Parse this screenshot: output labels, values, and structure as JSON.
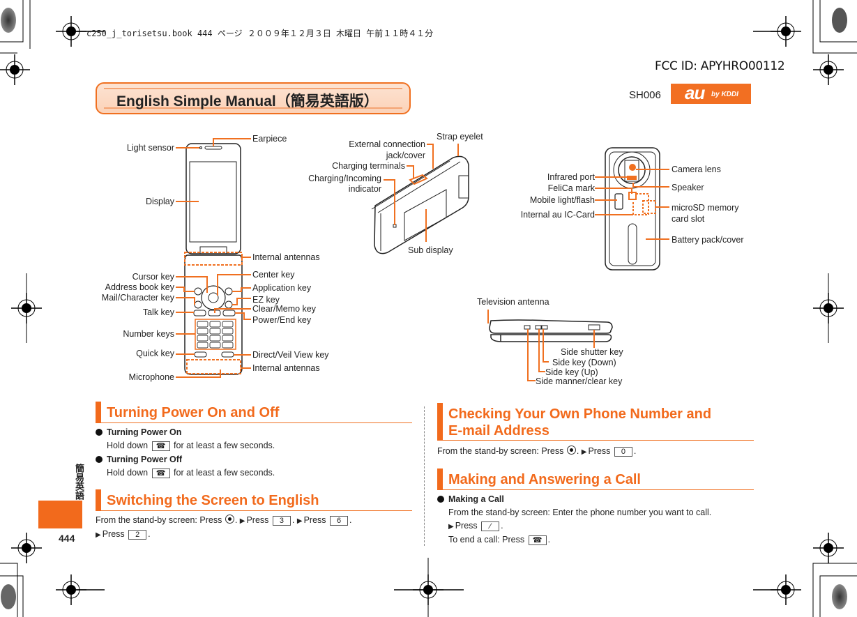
{
  "print_header": {
    "text": "c250_j_torisetsu.book  444 ページ  ２００９年１２月３日  木曜日  午前１１時４１分",
    "fcc_id": "FCC ID: APYHRO00112"
  },
  "title_banner": {
    "title": "English Simple Manual（簡易英語版）",
    "model": "SH006",
    "logo_main": "au",
    "logo_sub": "by KDDI"
  },
  "colors": {
    "accent": "#f26a1c",
    "banner_fill": "#fde3d2",
    "text": "#222222"
  },
  "diagram_front": {
    "labels_left": [
      "Light sensor",
      "Display",
      "Cursor key",
      "Address book key",
      "Mail/Character key",
      "Talk key",
      "Number keys",
      "Quick key",
      "Microphone"
    ],
    "labels_right": [
      "Earpiece",
      "Internal antennas",
      "Center key",
      "Application key",
      "EZ key",
      "Clear/Memo key",
      "Power/End key",
      "Direct/Veil View key",
      "Internal antennas"
    ]
  },
  "diagram_closed": {
    "labels": [
      "External connection",
      "jack/cover",
      "Strap eyelet",
      "Charging terminals",
      "Charging/Incoming",
      "indicator",
      "Sub display"
    ]
  },
  "diagram_back": {
    "labels_left": [
      "Infrared port",
      "FeliCa mark",
      "Mobile light/flash",
      "Internal au IC-Card"
    ],
    "labels_right": [
      "Camera lens",
      "Speaker",
      "microSD memory",
      "card slot",
      "Battery pack/cover"
    ]
  },
  "diagram_side": {
    "labels": [
      "Television antenna",
      "Side shutter key",
      "Side key (Down)",
      "Side key (Up)",
      "Side manner/clear key"
    ]
  },
  "sections": {
    "power": {
      "heading": "Turning Power On and Off",
      "items": [
        {
          "title": "Turning Power On",
          "pre": "Hold down",
          "key_icon": "power-end-key",
          "post": "for at least a few seconds."
        },
        {
          "title": "Turning Power Off",
          "pre": "Hold down",
          "key_icon": "power-end-key",
          "post": "for at least a few seconds."
        }
      ]
    },
    "english": {
      "heading": "Switching the Screen to English",
      "line1_a": "From the stand-by screen: Press",
      "press": "Press",
      "keys": [
        "3",
        "6",
        "2"
      ]
    },
    "own_number": {
      "heading_line1": "Checking Your Own Phone Number and",
      "heading_line2": "E-mail Address",
      "line_a": "From the stand-by screen: Press",
      "press": "Press",
      "key": "0"
    },
    "call": {
      "heading": "Making and Answering a Call",
      "item_title": "Making a Call",
      "line1": "From the stand-by screen: Enter the phone number you want to call.",
      "press": "Press",
      "line3_pre": "To end a call: Press"
    }
  },
  "side_tab": {
    "vertical_label": "簡易英語",
    "page_number": "444"
  }
}
